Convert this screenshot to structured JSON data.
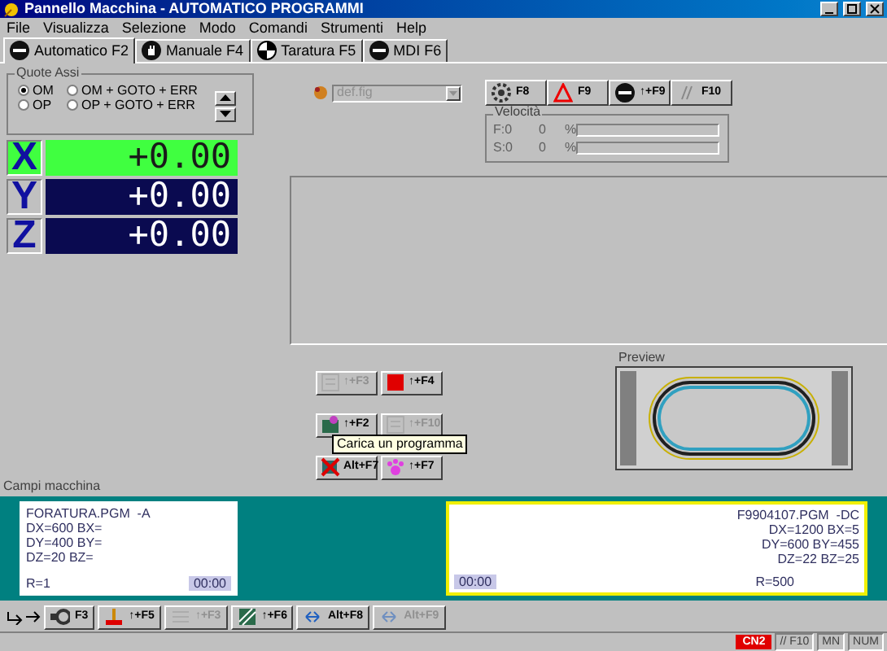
{
  "window": {
    "title": "Pannello Macchina - AUTOMATICO PROGRAMMI"
  },
  "menu": [
    "File",
    "Visualizza",
    "Selezione",
    "Modo",
    "Comandi",
    "Strumenti",
    "Help"
  ],
  "tabs": [
    {
      "label": "Automatico F2",
      "selected": true
    },
    {
      "label": "Manuale F4",
      "selected": false
    },
    {
      "label": "Taratura F5",
      "selected": false
    },
    {
      "label": "MDI F6",
      "selected": false
    }
  ],
  "quote_assi": {
    "title": "Quote Assi",
    "options": [
      {
        "label": "OM",
        "selected": true
      },
      {
        "label": "OM + GOTO + ERR",
        "selected": false
      },
      {
        "label": "OP",
        "selected": false
      },
      {
        "label": "OP + GOTO + ERR",
        "selected": false
      }
    ]
  },
  "axes": [
    {
      "name": "X",
      "value": "+0.00",
      "selected": true
    },
    {
      "name": "Y",
      "value": "+0.00",
      "selected": false
    },
    {
      "name": "Z",
      "value": "+0.00",
      "selected": false
    }
  ],
  "file_dropdown": {
    "value": "def.fig",
    "disabled": true
  },
  "function_keys": [
    {
      "label": "F8"
    },
    {
      "label": "F9"
    },
    {
      "label": "↑+F9"
    },
    {
      "label": "F10"
    }
  ],
  "velocita": {
    "title": "Velocità",
    "rows": [
      {
        "label": "F:0",
        "value": "0",
        "unit": "%"
      },
      {
        "label": "S:0",
        "value": "0",
        "unit": "%"
      }
    ]
  },
  "program_buttons": [
    {
      "label": "↑+F3",
      "disabled": true
    },
    {
      "label": "↑+F4",
      "disabled": false
    },
    {
      "label": "↑+F2",
      "disabled": false
    },
    {
      "label": "↑+F10",
      "disabled": true
    },
    {
      "label": "Alt+F7",
      "disabled": false
    },
    {
      "label": "↑+F7",
      "disabled": false
    }
  ],
  "tooltip": "Carica un programma",
  "preview": {
    "title": "Preview"
  },
  "campi_macchina": {
    "title": "Campi macchina",
    "fields": [
      {
        "selected": false,
        "lines": [
          "FORATURA.PGM  -A",
          "DX=600 BX=",
          "DY=400 BY=",
          "DZ=20 BZ="
        ],
        "r": "R=1",
        "time": "00:00"
      },
      {
        "selected": true,
        "lines": [
          "F9904107.PGM  -DC",
          "DX=1200 BX=5",
          "DY=600 BY=455",
          "DZ=22 BZ=25"
        ],
        "r": "R=500",
        "time": "00:00"
      }
    ]
  },
  "bottom_toolbar": [
    {
      "label": "F3",
      "disabled": false
    },
    {
      "label": "↑+F5",
      "disabled": false
    },
    {
      "label": "↑+F3",
      "disabled": true
    },
    {
      "label": "↑+F6",
      "disabled": false
    },
    {
      "label": "Alt+F8",
      "disabled": false
    },
    {
      "label": "Alt+F9",
      "disabled": true
    }
  ],
  "status_bar": [
    {
      "text": "CN2",
      "kind": "alarm"
    },
    {
      "text": "// F10",
      "kind": "plain"
    },
    {
      "text": "MN",
      "kind": "plain"
    },
    {
      "text": "NUM",
      "kind": "plain"
    }
  ]
}
